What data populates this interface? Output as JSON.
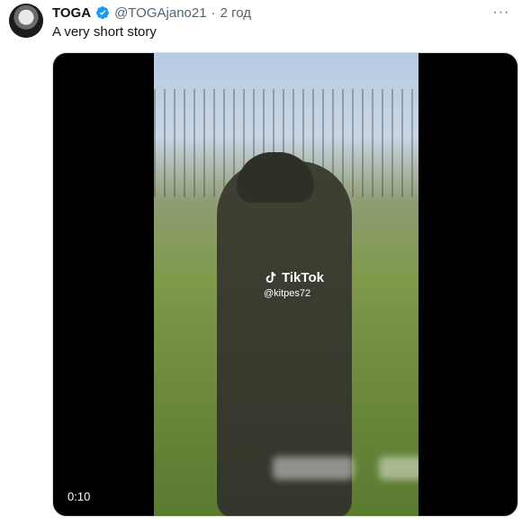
{
  "tweet": {
    "name": "TOGA",
    "handle": "@TOGAjano21",
    "separator": "·",
    "time": "2 год",
    "text": "A very short story",
    "more": "···"
  },
  "video": {
    "duration": "0:10",
    "watermark_brand": "TikTok",
    "watermark_user": "@kitpes72"
  },
  "colors": {
    "verified": "#1d9bf0",
    "muted": "#536471"
  }
}
